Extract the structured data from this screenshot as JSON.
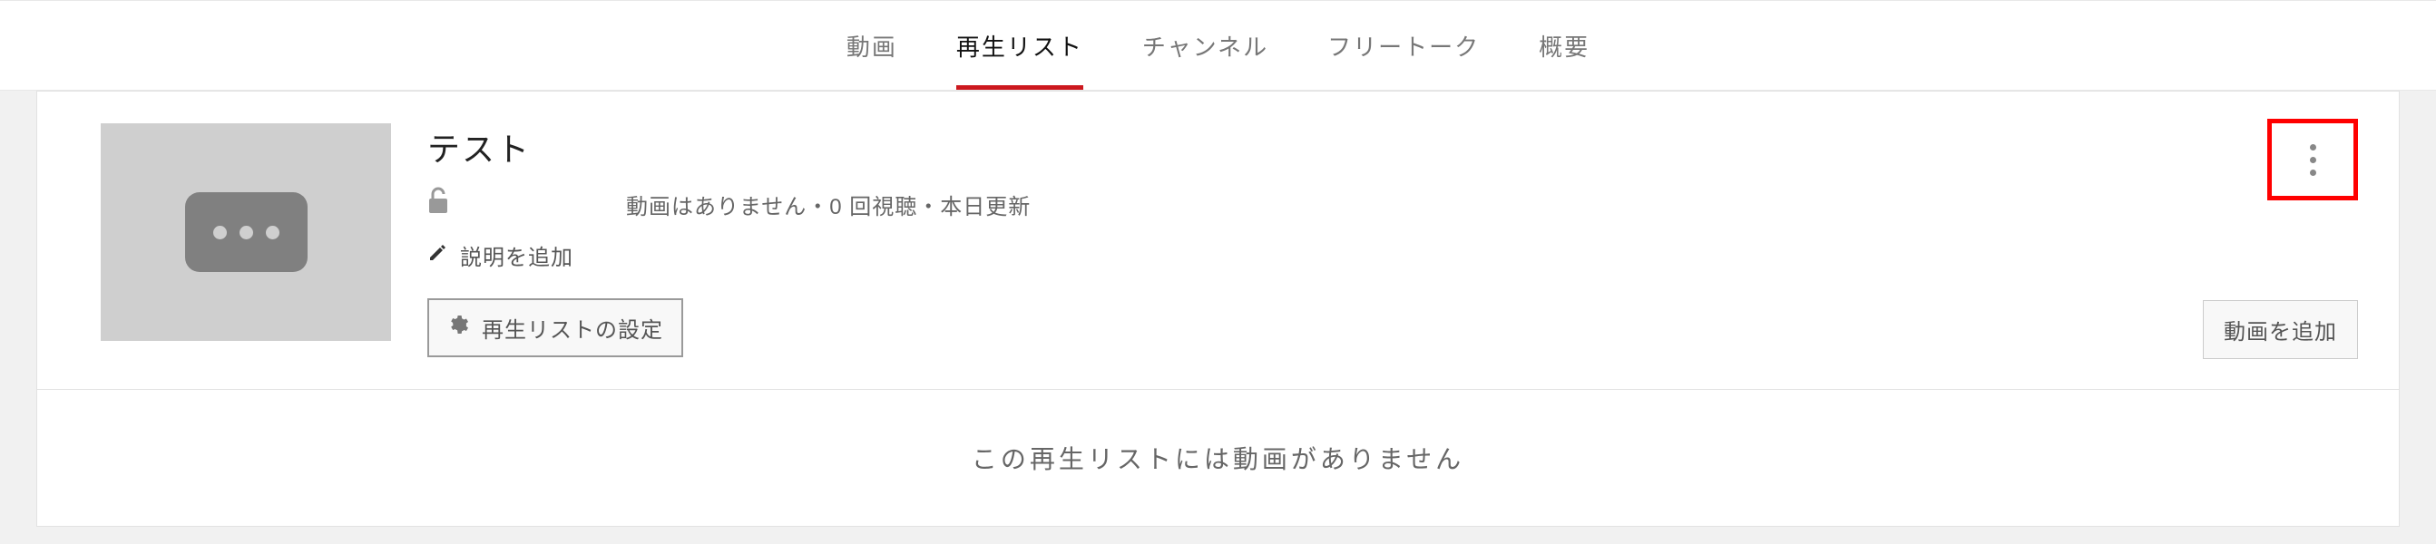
{
  "tabs": {
    "items": [
      {
        "label": "動画",
        "active": false
      },
      {
        "label": "再生リスト",
        "active": true
      },
      {
        "label": "チャンネル",
        "active": false
      },
      {
        "label": "フリートーク",
        "active": false
      },
      {
        "label": "概要",
        "active": false
      }
    ]
  },
  "playlist": {
    "title": "テスト",
    "privacy_status": "unlocked",
    "meta": "動画はありません・0 回視聴・本日更新",
    "add_description_label": "説明を追加",
    "settings_button_label": "再生リストの設定",
    "add_video_button_label": "動画を追加"
  },
  "empty_state": {
    "message": "この再生リストには動画がありません"
  }
}
